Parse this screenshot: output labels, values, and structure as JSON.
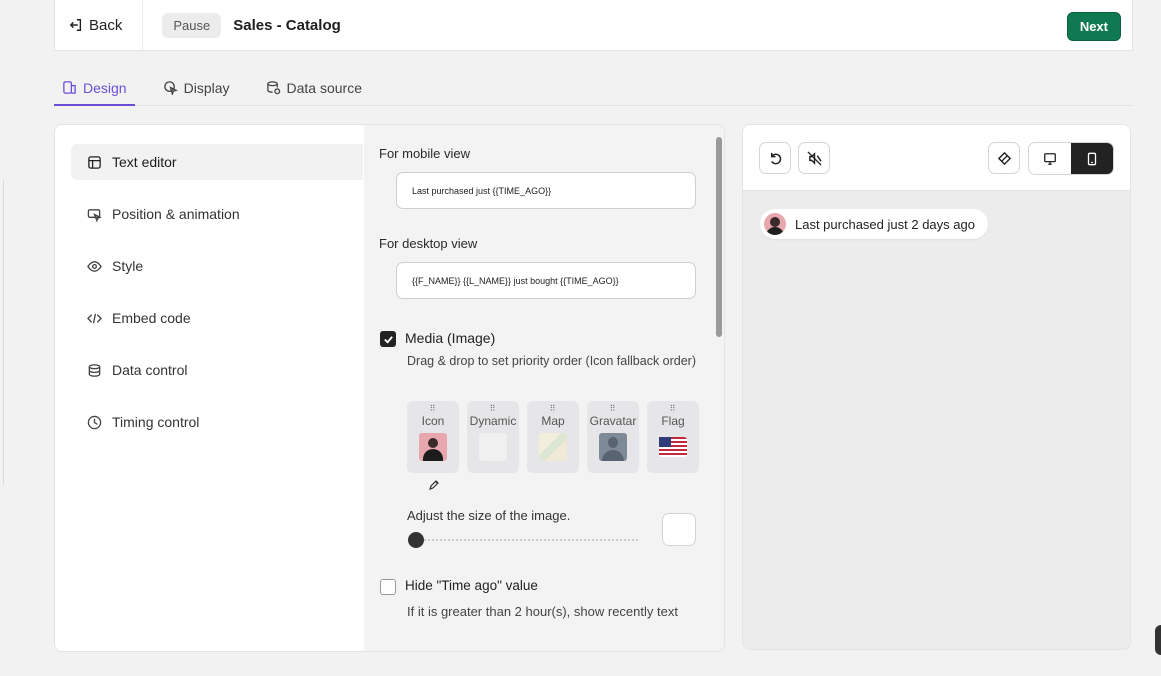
{
  "header": {
    "back_label": "Back",
    "status_badge": "Pause",
    "title": "Sales - Catalog",
    "next_label": "Next"
  },
  "tabs": [
    {
      "label": "Design",
      "active": true
    },
    {
      "label": "Display"
    },
    {
      "label": "Data source"
    }
  ],
  "sidenav": [
    {
      "label": "Text editor",
      "icon": "layout-icon",
      "active": true
    },
    {
      "label": "Position & animation",
      "icon": "cursor-icon"
    },
    {
      "label": "Style",
      "icon": "eye-icon"
    },
    {
      "label": "Embed code",
      "icon": "code-icon"
    },
    {
      "label": "Data control",
      "icon": "database-icon"
    },
    {
      "label": "Timing control",
      "icon": "clock-icon"
    }
  ],
  "editor": {
    "mobile_label": "For mobile view",
    "mobile_value": "Last purchased just {{TIME_AGO}}",
    "desktop_label": "For desktop view",
    "desktop_value": "{{F_NAME}} {{L_NAME}} just bought {{TIME_AGO}}",
    "media_label": "Media (Image)",
    "media_checked": true,
    "media_desc": "Drag & drop to set priority order (Icon fallback order)",
    "media_cards": [
      {
        "label": "Icon"
      },
      {
        "label": "Dynamic"
      },
      {
        "label": "Map"
      },
      {
        "label": "Gravatar"
      },
      {
        "label": "Flag"
      }
    ],
    "size_label": "Adjust the size of the image.",
    "size_value": 0,
    "hide_label": "Hide \"Time ago\" value",
    "hide_checked": false,
    "hide_desc": "If it is greater than 2 hour(s), show recently text"
  },
  "preview": {
    "notification_text": "Last purchased just 2 days ago",
    "device_mode": "mobile"
  },
  "colors": {
    "accent": "#6a4fd6",
    "next_button": "#0f7a52"
  }
}
